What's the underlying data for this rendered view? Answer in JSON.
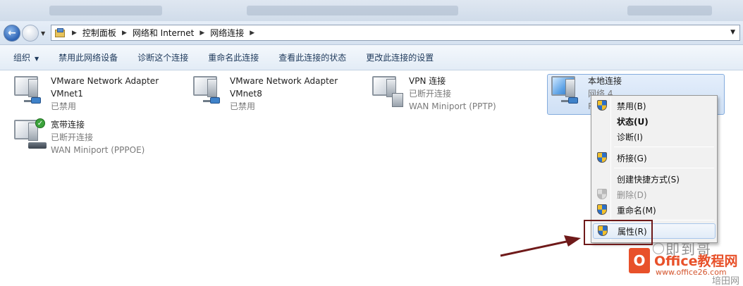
{
  "address_bar": {
    "crumbs": [
      "控制面板",
      "网络和 Internet",
      "网络连接"
    ]
  },
  "toolbar": {
    "organize": "组织",
    "items": [
      "禁用此网络设备",
      "诊断这个连接",
      "重命名此连接",
      "查看此连接的状态",
      "更改此连接的设置"
    ]
  },
  "connections": [
    {
      "name": "VMware Network Adapter",
      "line2": "VMnet1",
      "line3": "已禁用",
      "icon": "network-adapter-icon"
    },
    {
      "name": "VMware Network Adapter",
      "line2": "VMnet8",
      "line3": "已禁用",
      "icon": "network-adapter-icon"
    },
    {
      "name": "VPN 连接",
      "line2": "已断开连接",
      "line3": "WAN Miniport (PPTP)",
      "icon": "vpn-icon"
    },
    {
      "name": "本地连接",
      "line2": "网络 4",
      "line3": "R",
      "icon": "lan-icon",
      "selected": true
    },
    {
      "name": "宽带连接",
      "line2": "已断开连接",
      "line3": "WAN Miniport (PPPOE)",
      "icon": "broadband-icon"
    }
  ],
  "context_menu": {
    "items": [
      {
        "label": "禁用(B)",
        "shield": true
      },
      {
        "label": "状态(U)",
        "bold": true
      },
      {
        "label": "诊断(I)"
      },
      {
        "label": "桥接(G)",
        "shield": true
      },
      {
        "label": "创建快捷方式(S)"
      },
      {
        "label": "删除(D)",
        "shield": true,
        "disabled": true
      },
      {
        "label": "重命名(M)",
        "shield": true
      },
      {
        "label": "属性(R)",
        "shield": true,
        "highlighted": true
      }
    ]
  },
  "watermark": {
    "author": "即到哥",
    "logo_letter": "O",
    "site_name": "Office教程网",
    "site_url": "www.office26.com",
    "corner": "培田网"
  },
  "colors": {
    "highlight_box": "#6f1a1a",
    "arrow": "#6f1a1a",
    "selection": "#cfe0f5"
  }
}
